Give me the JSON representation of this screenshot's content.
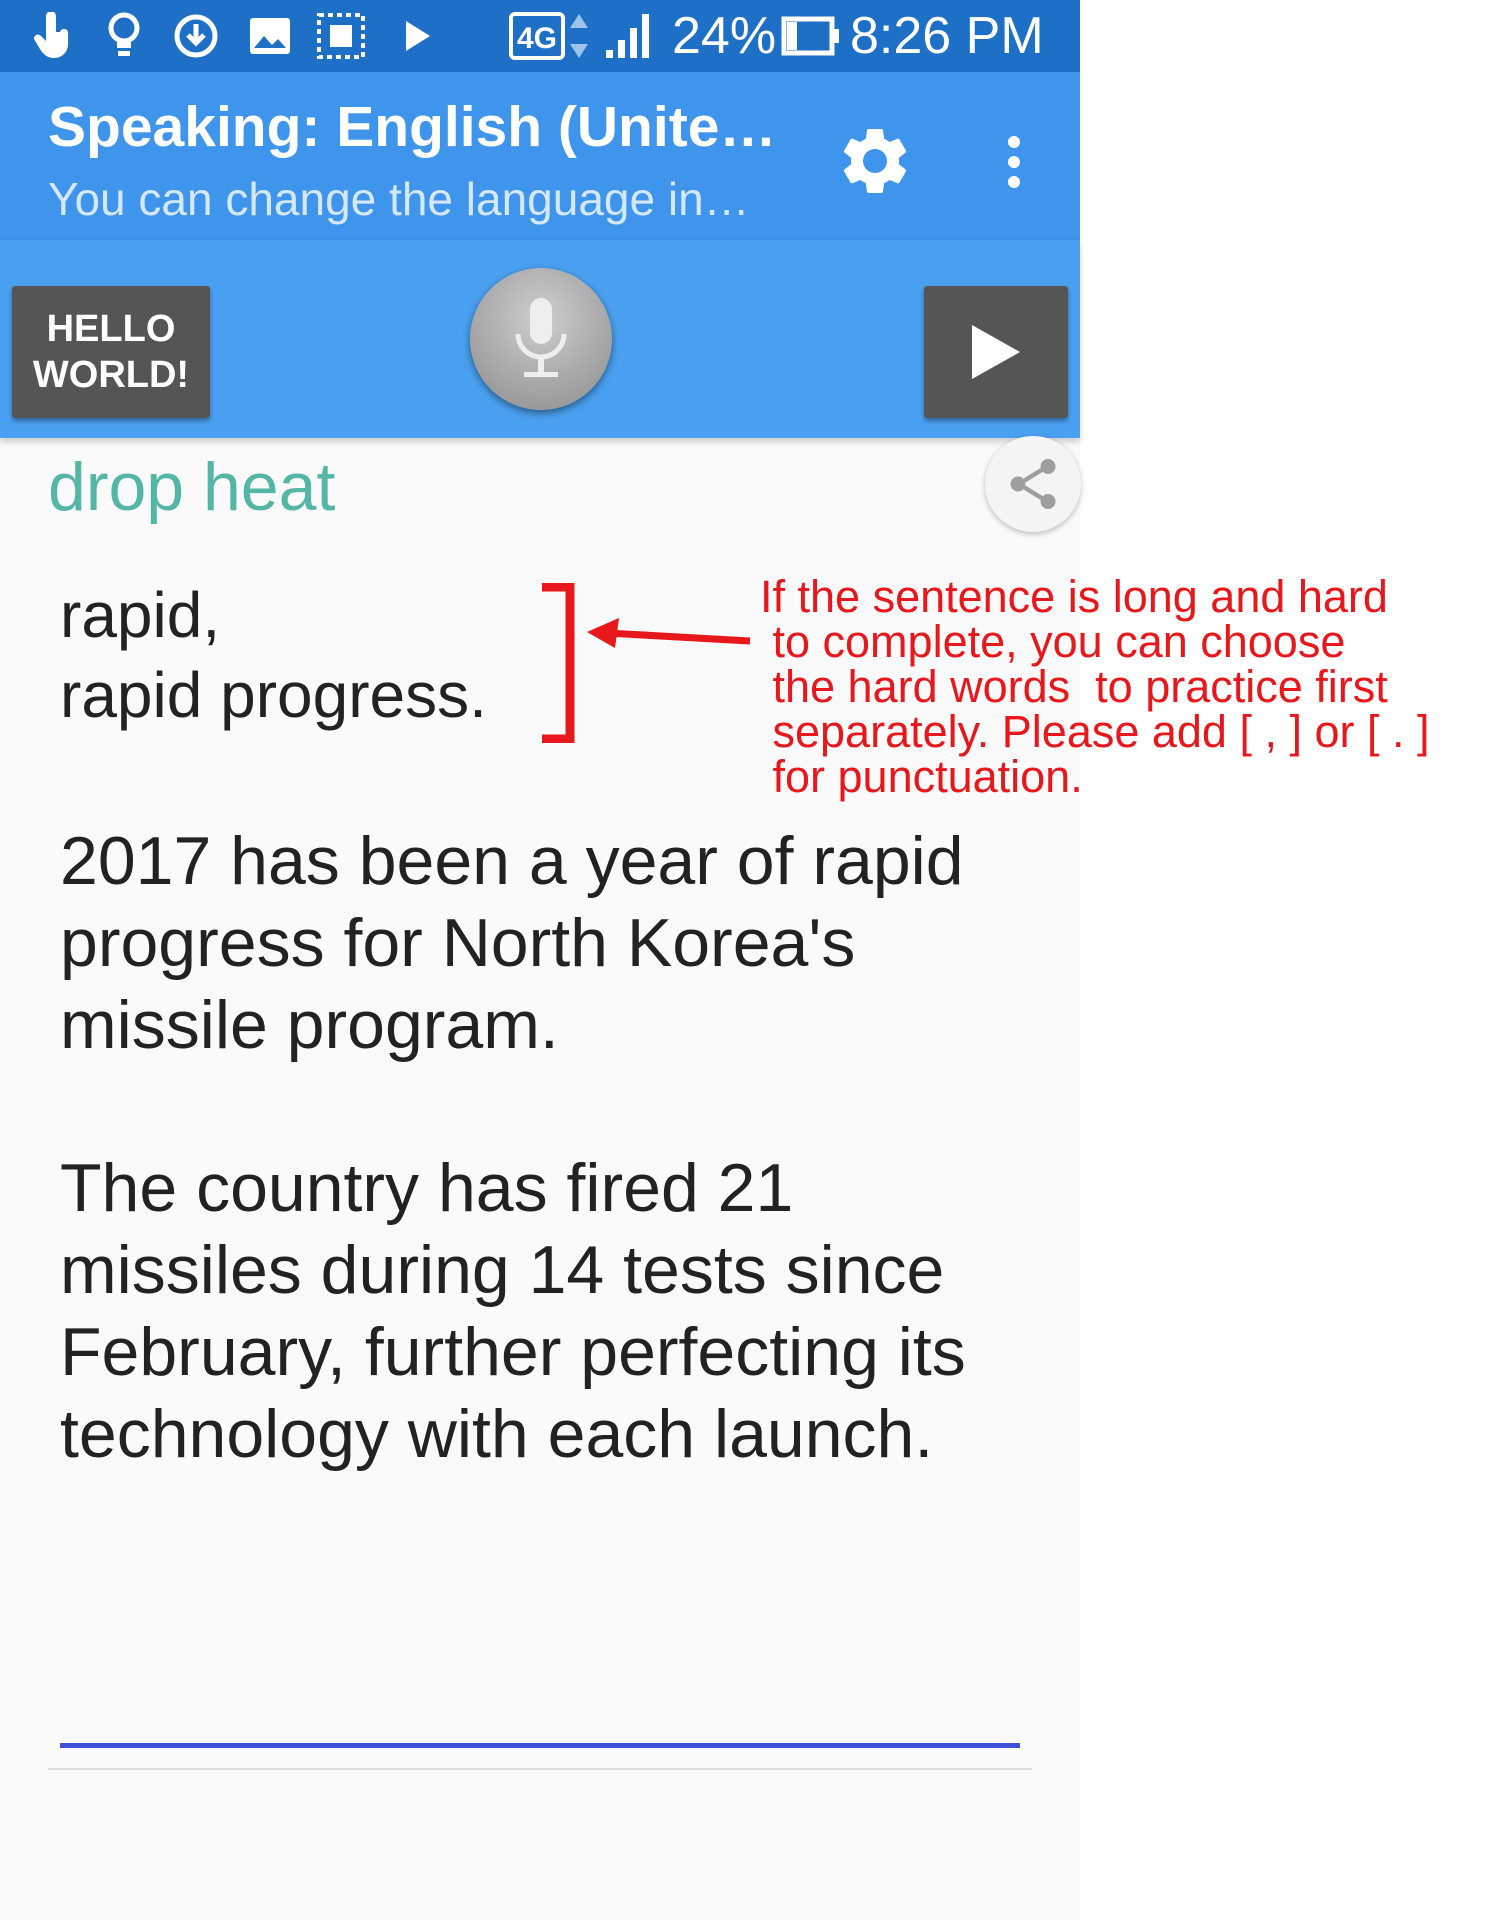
{
  "status_bar": {
    "network": "4G",
    "battery": "24%",
    "time": "8:26 PM",
    "icons": [
      "touch-icon",
      "bulb-icon",
      "download-icon",
      "image-icon",
      "screenshot-icon",
      "play-store-icon",
      "network-4g-icon",
      "signal-icon",
      "battery-icon"
    ]
  },
  "app_bar": {
    "title": "Speaking: English (Unite…",
    "subtitle": "You can change the language in…",
    "actions": [
      "gear-icon",
      "more-vert-icon"
    ]
  },
  "controls": {
    "hello_button_label": "HELLO\nWORLD!",
    "mic_icon": "microphone-icon",
    "play_icon": "play-icon"
  },
  "content": {
    "phrase_header": "drop heat",
    "practice_lines": [
      "rapid,",
      "rapid progress."
    ],
    "paragraphs": [
      "2017 has been a year of rapid progress for North Korea's missile program.",
      "The country has fired 21 missiles during 14 tests since February, further perfecting its technology with each launch."
    ],
    "input_value": "",
    "accent_color": "#54b7a6"
  },
  "annotation": {
    "text": "If the sentence is long and hard\n to complete, you can choose\n the hard words  to practice first\n separately. Please add [ , ] or [ . ]\n for punctuation.",
    "color": "#e8171c"
  },
  "colors": {
    "status_bar": "#1e6fc6",
    "app_bar": "#3f94eb",
    "control_strip": "#4aa0f0",
    "button_dark": "#555555",
    "input_underline": "#3f51d8"
  }
}
